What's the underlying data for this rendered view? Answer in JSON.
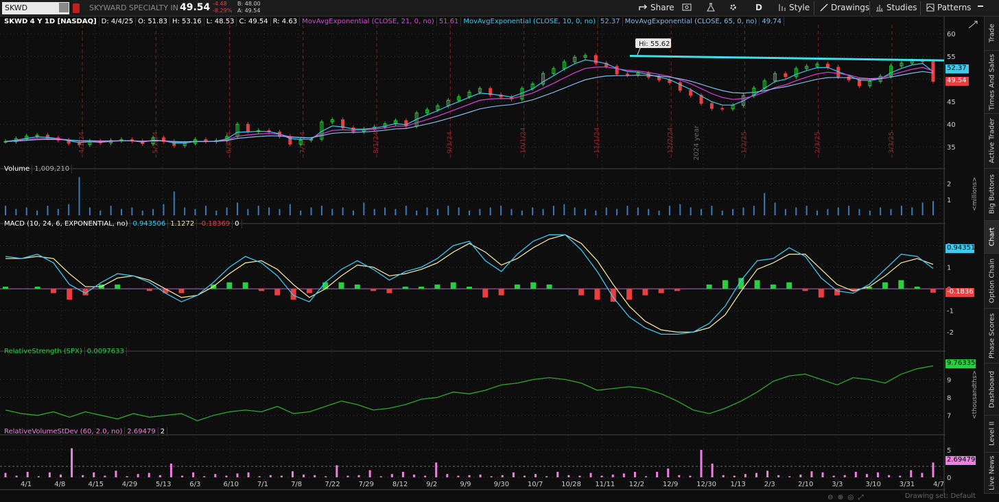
{
  "topbar": {
    "symbol": "SKWD",
    "company": "SKYWARD SPECIALTY IN",
    "last": "49.54",
    "change": "-4.48",
    "change_pct": "-8.29%",
    "bid": "B: 48.00",
    "ask": "A: 49.54",
    "buttons": [
      "Share",
      "D",
      "Style",
      "Drawings",
      "Studies",
      "Patterns"
    ]
  },
  "header": {
    "title": "SKWD 4 Y 1D [NASDAQ]",
    "date": "D: 4/4/25",
    "open": "O: 51.83",
    "high": "H: 53.16",
    "low": "L: 48.53",
    "close": "C: 49.54",
    "range": "R: 4.63",
    "ma21": "MovAvgExponential (CLOSE, 21, 0, no)",
    "ma21_val": "51.61",
    "ma10": "MovAvgExponential (CLOSE, 10, 0, no)",
    "ma10_val": "52.37",
    "ma65": "MovAvgExponential (CLOSE, 65, 0, no)",
    "ma65_val": "49.74"
  },
  "hi_label": "Hi: 55.62",
  "year_label": "2024 year",
  "price_badges": {
    "ma10": "52.37",
    "last": "49.54"
  },
  "volume": {
    "label": "Volume",
    "value": "1,009,210",
    "unit": "<millions>"
  },
  "macd": {
    "label": "MACD (10, 24, 6, EXPONENTIAL, no)",
    "value": "0.943506",
    "avg": "1.1272",
    "diff": "-0.18369",
    "zero": "0",
    "badge_value": "0.94351",
    "badge_diff": "-0.1836"
  },
  "rs": {
    "label": "RelativeStrength (SPX)",
    "value": "0.0097633",
    "badge": "9.76335",
    "unit": "<thousandths>"
  },
  "rv": {
    "label": "RelativeVolumeStDev (60, 2.0, no)",
    "value": "2.69479",
    "extra": "2",
    "badge": "2.69479"
  },
  "x_ticks": [
    "4/1",
    "4/8",
    "4/15",
    "4/29",
    "5/13",
    "6/3",
    "6/10",
    "7/1",
    "7/8",
    "7/22",
    "7/29",
    "8/12",
    "9/2",
    "9/9",
    "9/30",
    "10/7",
    "10/28",
    "11/11",
    "12/2",
    "12/9",
    "12/30",
    "1/13",
    "2/3",
    "2/10",
    "3/3",
    "3/10",
    "3/31",
    "4/7"
  ],
  "month_ticks": [
    "4/1/24",
    "5/1/24",
    "6/3/24",
    "7/1/24",
    "8/1/24",
    "9/3/24",
    "10/1/24",
    "11/1/24",
    "12/2/24",
    "1/2/25",
    "2/3/25",
    "3/3/25"
  ],
  "sidebar": [
    "Trade",
    "Times And Sales",
    "Active Trader",
    "Big Buttons",
    "Chart",
    "Option Chain",
    "Phase Scores",
    "Dashboard",
    "Level II",
    "Live News"
  ],
  "drawing_set": "Drawing set: Default",
  "colors": {
    "up": "#2ecc40",
    "down": "#e84040",
    "ma10": "#40c8e8",
    "ma21": "#e040e0",
    "ma65": "#88b8e8",
    "trendline": "#40e0e8",
    "macd": "#40c8f0",
    "avg": "#f0e0a0",
    "rs": "#2ea82e",
    "rv": "#f080e0",
    "volume": "#3a7ab8"
  },
  "chart_data": [
    {
      "type": "candlestick",
      "name": "price",
      "y_ticks": [
        35,
        40,
        45,
        50,
        55,
        60
      ],
      "ylim": [
        32,
        62
      ],
      "trendline": [
        55.1,
        54.1
      ],
      "hi": 55.62,
      "close": [
        36.2,
        36.8,
        37.4,
        37.6,
        37.0,
        36.5,
        35.8,
        35.5,
        36.3,
        35.9,
        36.4,
        36.6,
        36.3,
        35.7,
        37.0,
        36.2,
        35.3,
        35.8,
        36.6,
        36.2,
        36.4,
        37.3,
        40.0,
        38.4,
        38.6,
        38.3,
        37.3,
        35.6,
        36.5,
        36.7,
        40.5,
        41.0,
        39.2,
        38.4,
        38.9,
        39.4,
        40.1,
        40.8,
        39.6,
        42.5,
        43.2,
        44.1,
        45.3,
        46.1,
        47.1,
        47.9,
        46.5,
        46.0,
        45.6,
        47.9,
        48.9,
        51.2,
        52.3,
        53.8,
        54.8,
        55.2,
        53.5,
        52.8,
        51.1,
        50.9,
        51.3,
        50.4,
        49.8,
        49.2,
        47.5,
        46.4,
        44.6,
        43.5,
        43.4,
        44.2,
        46.3,
        48.0,
        49.6,
        51.2,
        50.5,
        52.3,
        52.8,
        53.3,
        52.6,
        50.5,
        49.8,
        48.5,
        49.5,
        50.6,
        52.9,
        53.5,
        54.0,
        53.8,
        49.5
      ]
    },
    {
      "type": "bar",
      "name": "volume",
      "y_ticks": [
        1,
        2
      ],
      "ylim": [
        0,
        2.5
      ],
      "values": [
        0.6,
        0.4,
        0.5,
        0.3,
        0.6,
        0.4,
        0.7,
        2.4,
        0.5,
        0.3,
        0.6,
        0.4,
        0.5,
        0.3,
        0.4,
        0.7,
        1.5,
        0.5,
        0.4,
        0.6,
        0.3,
        0.5,
        0.8,
        0.4,
        0.6,
        0.5,
        0.4,
        0.7,
        0.3,
        0.5,
        0.6,
        0.4,
        0.5,
        0.3,
        0.8,
        0.4,
        0.5,
        0.4,
        0.6,
        0.3,
        0.5,
        0.4,
        0.6,
        0.5,
        0.3,
        0.4,
        0.5,
        0.6,
        0.4,
        0.3,
        0.5,
        0.4,
        0.6,
        0.7,
        0.5,
        0.4,
        0.3,
        0.5,
        0.4,
        0.6,
        0.5,
        0.4,
        0.3,
        0.6,
        0.7,
        0.5,
        0.4,
        0.6,
        0.3,
        0.4,
        0.5,
        0.6,
        1.4,
        0.8,
        0.4,
        0.5,
        0.6,
        0.3,
        0.4,
        0.5,
        0.6,
        0.4,
        0.3,
        0.5,
        0.4,
        0.6,
        0.5,
        0.8,
        0.9
      ]
    },
    {
      "type": "line",
      "name": "MACD",
      "y_ticks": [
        -2,
        -1,
        0,
        1,
        2
      ],
      "ylim": [
        -2.5,
        2.7
      ],
      "macd": [
        1.5,
        1.4,
        1.6,
        1.2,
        0.2,
        -0.2,
        0.3,
        0.7,
        0.6,
        0.3,
        -0.2,
        -0.6,
        -0.3,
        0.3,
        1.0,
        1.5,
        1.2,
        0.6,
        -0.3,
        -0.6,
        0.3,
        0.9,
        1.3,
        0.9,
        0.4,
        0.8,
        1.0,
        1.4,
        2.0,
        2.2,
        1.3,
        0.8,
        1.6,
        2.2,
        2.5,
        2.5,
        1.8,
        0.8,
        -0.4,
        -1.3,
        -1.8,
        -2.1,
        -2.1,
        -2.0,
        -1.6,
        -0.8,
        0.4,
        1.3,
        1.4,
        1.9,
        1.5,
        0.5,
        -0.1,
        -0.2,
        0.2,
        0.9,
        1.6,
        1.5,
        0.94
      ],
      "signal": [
        1.4,
        1.4,
        1.5,
        1.4,
        0.7,
        0.1,
        0.1,
        0.5,
        0.6,
        0.4,
        0.0,
        -0.4,
        -0.3,
        0.1,
        0.7,
        1.2,
        1.3,
        0.9,
        0.2,
        -0.4,
        0.0,
        0.6,
        1.1,
        1.0,
        0.6,
        0.7,
        0.9,
        1.2,
        1.7,
        2.1,
        1.7,
        1.1,
        1.4,
        1.9,
        2.3,
        2.5,
        2.1,
        1.3,
        0.2,
        -0.8,
        -1.5,
        -1.9,
        -2.0,
        -2.0,
        -1.8,
        -1.2,
        -0.1,
        0.9,
        1.2,
        1.6,
        1.6,
        0.9,
        0.2,
        -0.1,
        0.1,
        0.6,
        1.2,
        1.4,
        1.13
      ],
      "hist": [
        0.1,
        0.0,
        0.1,
        -0.2,
        -0.5,
        -0.3,
        0.2,
        0.2,
        0.0,
        -0.1,
        -0.2,
        -0.2,
        0.0,
        0.2,
        0.3,
        0.3,
        -0.1,
        -0.3,
        -0.5,
        -0.2,
        0.3,
        0.3,
        0.2,
        -0.1,
        -0.2,
        0.1,
        0.1,
        0.2,
        0.3,
        0.1,
        -0.4,
        -0.3,
        0.2,
        0.3,
        0.2,
        0.0,
        -0.3,
        -0.5,
        -0.6,
        -0.5,
        -0.3,
        -0.2,
        -0.1,
        0.0,
        0.2,
        0.4,
        0.5,
        0.4,
        0.2,
        0.3,
        -0.1,
        -0.4,
        -0.3,
        -0.1,
        0.1,
        0.3,
        0.4,
        0.1,
        -0.18
      ]
    },
    {
      "type": "line",
      "name": "RelativeStrength",
      "y_ticks": [
        7,
        8,
        9
      ],
      "ylim": [
        6.3,
        10.2
      ],
      "values": [
        7.3,
        7.1,
        7.0,
        7.2,
        6.9,
        7.2,
        7.0,
        6.8,
        7.1,
        6.9,
        7.0,
        7.1,
        6.7,
        7.0,
        7.2,
        7.3,
        7.2,
        7.5,
        7.1,
        7.2,
        7.5,
        7.8,
        7.6,
        7.3,
        7.4,
        7.6,
        7.9,
        8.0,
        8.3,
        8.2,
        8.4,
        8.7,
        8.8,
        9.0,
        9.1,
        9.0,
        8.8,
        8.4,
        8.5,
        8.6,
        8.5,
        8.2,
        7.8,
        7.3,
        7.1,
        7.4,
        7.8,
        8.3,
        8.9,
        9.2,
        9.3,
        9.0,
        8.7,
        9.1,
        9.0,
        8.8,
        9.3,
        9.6,
        9.76
      ]
    },
    {
      "type": "bar",
      "name": "RelativeVolumeStDev",
      "y_ticks": [
        0,
        5
      ],
      "ylim": [
        0,
        6.5
      ],
      "values": [
        0.8,
        0.3,
        1.0,
        0.2,
        0.9,
        0.5,
        5.3,
        0.4,
        0.9,
        0.3,
        1.2,
        0.2,
        0.6,
        0.8,
        0.4,
        2.5,
        0.3,
        0.9,
        0.2,
        0.6,
        0.3,
        0.7,
        0.9,
        0.2,
        0.4,
        0.3,
        1.1,
        0.5,
        0.4,
        0.2,
        2.2,
        0.3,
        0.4,
        1.3,
        0.2,
        0.6,
        1.0,
        0.5,
        0.3,
        2.7,
        0.6,
        0.3,
        0.4,
        0.5,
        0.2,
        0.4,
        0.9,
        0.3,
        0.6,
        0.2,
        1.0,
        0.4,
        0.3,
        0.8,
        0.3,
        0.5,
        0.7,
        1.0,
        0.2,
        1.0,
        1.6,
        0.4,
        0.3,
        5.0,
        2.5,
        0.4,
        0.3,
        0.6,
        0.8,
        1.2,
        0.4,
        0.2,
        0.5,
        1.1,
        0.9,
        0.3,
        0.4,
        1.0,
        0.6,
        0.9,
        0.4,
        0.3,
        1.3,
        0.8,
        2.69
      ]
    }
  ]
}
